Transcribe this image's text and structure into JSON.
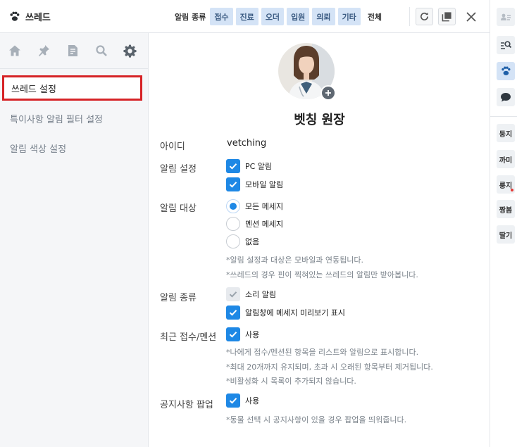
{
  "app": {
    "title": "쓰레드"
  },
  "filters": {
    "label": "알림 종류",
    "chips": [
      "접수",
      "진료",
      "오더",
      "입원",
      "의뢰",
      "기타"
    ],
    "all_label": "전체"
  },
  "sidebar": {
    "items": [
      {
        "label": "쓰레드 설정",
        "active": true
      },
      {
        "label": "특이사항 알림 필터 설정",
        "active": false
      },
      {
        "label": "알림 색상 설정",
        "active": false
      }
    ]
  },
  "profile": {
    "name": "벳칭 원장"
  },
  "settings": {
    "id": {
      "label": "아이디",
      "value": "vetching"
    },
    "alert_settings": {
      "label": "알림 설정",
      "options": [
        {
          "label": "PC 알림",
          "checked": true
        },
        {
          "label": "모바일 알림",
          "checked": true
        }
      ]
    },
    "alert_target": {
      "label": "알림 대상",
      "options": [
        {
          "label": "모든 메세지",
          "selected": true
        },
        {
          "label": "멘션 메세지",
          "selected": false
        },
        {
          "label": "없음",
          "selected": false
        }
      ],
      "notes": [
        "*알림 설정과 대상은 모바일과 연동됩니다.",
        "*쓰레드의 경우 핀이 찍혀있는 쓰레드의 알림만 받아봅니다."
      ]
    },
    "alert_type": {
      "label": "알림 종류",
      "options": [
        {
          "label": "소리 알림",
          "checked": true,
          "disabled": true
        },
        {
          "label": "알림창에 메세지 미리보기 표시",
          "checked": true,
          "disabled": false
        }
      ]
    },
    "recent": {
      "label": "최근 접수/멘션",
      "option": "사용",
      "notes": [
        "*나에게 접수/멘션된 항목을 리스트와 알림으로 표시합니다.",
        "*최대 20개까지 유지되며, 초과 시 오래된 항목부터 제거됩니다.",
        "*비활성화 시 목록이 추가되지 않습니다."
      ]
    },
    "notice_popup": {
      "label": "공지사항 팝업",
      "option": "사용",
      "notes": [
        "*동물 선택 시 공지사항이 있을 경우 팝업을 띄워줍니다."
      ]
    }
  },
  "right_rail": {
    "pet_tabs": [
      {
        "label": "둥지",
        "dot": false
      },
      {
        "label": "까미",
        "dot": false
      },
      {
        "label": "룽지",
        "dot": true
      },
      {
        "label": "짱봄",
        "dot": false
      },
      {
        "label": "딸기",
        "dot": false
      }
    ]
  },
  "colors": {
    "accent": "#1e88e5",
    "chip_bg": "#d4e3f6",
    "active_outline": "#d62326"
  }
}
